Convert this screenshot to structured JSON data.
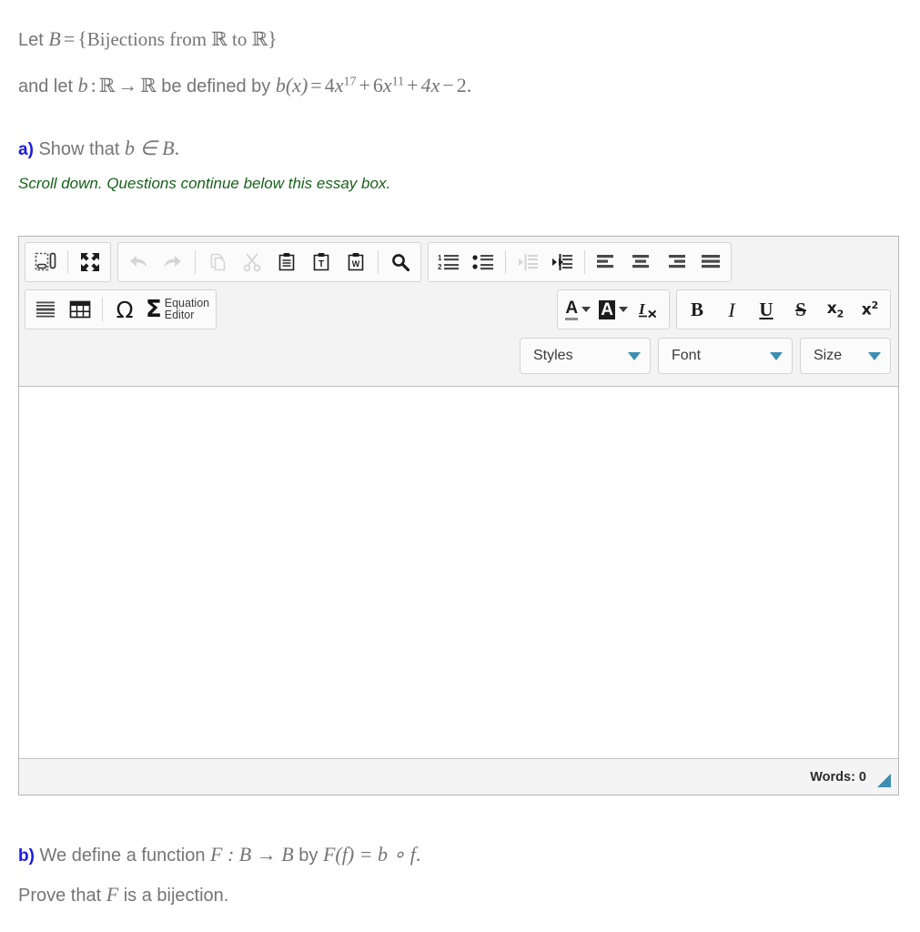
{
  "problem": {
    "line1": {
      "pre": "Let ",
      "var_b_set": "B",
      "eq": "=",
      "brace_open": "{",
      "text": "Bijections from ",
      "reals1": "ℝ",
      "to": " to ",
      "reals2": "ℝ",
      "brace_close": "}"
    },
    "line2": {
      "pre": "and let ",
      "fn": "b",
      "colon": ":",
      "reals1": "ℝ",
      "arrow": "→",
      "reals2": "ℝ",
      "mid": " be defined by ",
      "fnx": "b(x)",
      "eq": "=",
      "term1_coef": "4",
      "term1_var": "x",
      "term1_pow": "17",
      "plus1": "+",
      "term2_coef": "6",
      "term2_var": "x",
      "term2_pow": "11",
      "plus2": "+",
      "term3": "4x",
      "minus": "−",
      "term4": "2."
    },
    "part_a": {
      "label": "a)",
      "text_pre": " Show that ",
      "math": "b ∈ B",
      "period": ".",
      "note": "Scroll down. Questions continue below this essay box."
    },
    "part_b": {
      "label": "b)",
      "line1_pre": " We define a function ",
      "line1_math1": "F : B → B",
      "line1_mid": " by ",
      "line1_math2": "F(f) = b ∘ f",
      "line1_end": ".",
      "line2_pre": "Prove that ",
      "line2_math": "F",
      "line2_post": " is a bijection."
    }
  },
  "editor": {
    "toolbar": {
      "group_doc": [
        {
          "name": "templates-icon",
          "label": "Templates",
          "disabled": false
        },
        {
          "name": "maximize-icon",
          "label": "Maximize",
          "disabled": false
        }
      ],
      "group_clipboard": [
        {
          "name": "undo-icon",
          "label": "Undo",
          "disabled": true
        },
        {
          "name": "redo-icon",
          "label": "Redo",
          "disabled": true
        },
        {
          "name": "copy-icon",
          "label": "Copy",
          "disabled": true
        },
        {
          "name": "cut-icon",
          "label": "Cut",
          "disabled": true
        },
        {
          "name": "paste-icon",
          "label": "Paste",
          "disabled": false
        },
        {
          "name": "paste-as-text-icon",
          "label": "Paste as plain text",
          "disabled": false
        },
        {
          "name": "paste-from-word-icon",
          "label": "Paste from Word",
          "disabled": false
        },
        {
          "name": "find-icon",
          "label": "Find",
          "disabled": false
        }
      ],
      "group_paragraph": [
        {
          "name": "numbered-list-icon",
          "label": "Insert/Remove Numbered List",
          "disabled": false
        },
        {
          "name": "bulleted-list-icon",
          "label": "Insert/Remove Bulleted List",
          "disabled": false
        },
        {
          "name": "outdent-icon",
          "label": "Decrease Indent",
          "disabled": true
        },
        {
          "name": "indent-icon",
          "label": "Increase Indent",
          "disabled": false
        },
        {
          "name": "align-left-icon",
          "label": "Align Left",
          "disabled": false
        },
        {
          "name": "align-center-icon",
          "label": "Center",
          "disabled": false
        },
        {
          "name": "align-right-icon",
          "label": "Align Right",
          "disabled": false
        },
        {
          "name": "justify-icon",
          "label": "Justify",
          "disabled": false
        }
      ],
      "group_insert": [
        {
          "name": "horizontal-rule-icon",
          "label": "Insert Horizontal Line",
          "disabled": false
        },
        {
          "name": "table-icon",
          "label": "Table",
          "disabled": false
        },
        {
          "name": "special-character-icon",
          "label": "Ω",
          "disabled": false
        }
      ],
      "equation_editor": {
        "sigma": "Σ",
        "label_line1": "Equation",
        "label_line2": "Editor"
      },
      "group_color": [
        {
          "name": "text-color-icon",
          "label": "A",
          "disabled": false
        },
        {
          "name": "background-color-icon",
          "label": "A",
          "disabled": false
        },
        {
          "name": "remove-format-icon",
          "label": "I",
          "disabled": false
        }
      ],
      "group_basicstyles": [
        {
          "name": "bold-button",
          "label": "B",
          "disabled": false
        },
        {
          "name": "italic-button",
          "label": "I",
          "disabled": false
        },
        {
          "name": "underline-button",
          "label": "U",
          "disabled": false
        },
        {
          "name": "strikethrough-button",
          "label": "S",
          "disabled": false
        },
        {
          "name": "subscript-button",
          "label": "x",
          "sub": "2",
          "disabled": false
        },
        {
          "name": "superscript-button",
          "label": "x",
          "sup": "2",
          "disabled": false
        }
      ],
      "dropdowns": [
        {
          "name": "styles-select",
          "label": "Styles"
        },
        {
          "name": "font-select",
          "label": "Font"
        },
        {
          "name": "size-select",
          "label": "Size"
        }
      ]
    },
    "body": {
      "content": "",
      "placeholder": ""
    },
    "status": {
      "word_count_label": "Words: 0"
    }
  },
  "colors": {
    "body_text": "#757575",
    "question_label": "#1a1ae6",
    "note_text": "#16621a",
    "accent_teal": "#3d8eb0",
    "toolbar_bg": "#f3f3f3",
    "group_bg": "#fbfbfb",
    "border": "#b6b6b6"
  }
}
